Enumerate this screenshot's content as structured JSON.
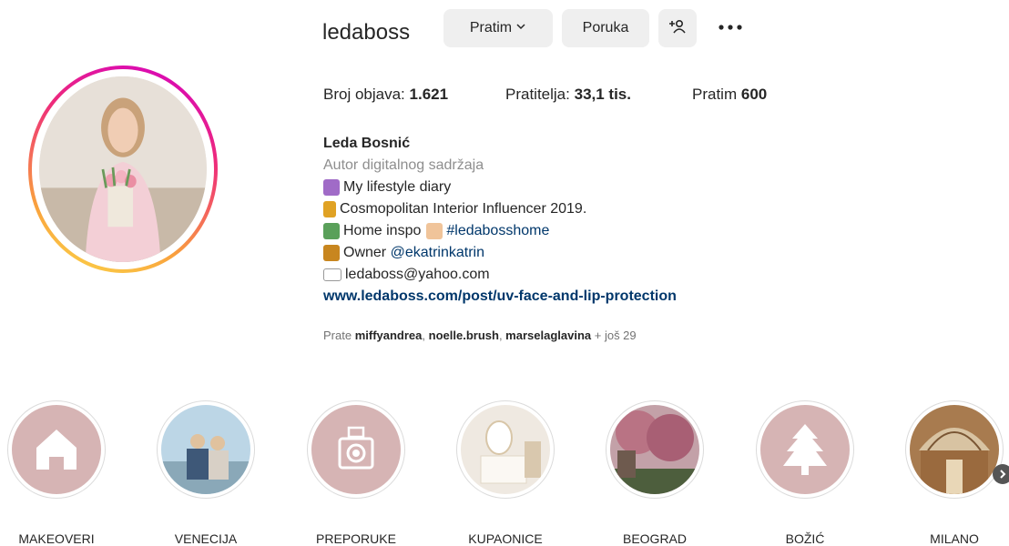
{
  "profile": {
    "username": "ledaboss",
    "follow_button": "Pratim",
    "message_button": "Poruka",
    "stats": {
      "posts_label": "Broj objava:",
      "posts_value": "1.621",
      "followers_label": "Pratitelja:",
      "followers_value": "33,1 tis.",
      "following_label": "Pratim",
      "following_value": "600"
    },
    "bio": {
      "full_name": "Leda Bosnić",
      "category": "Autor digitalnog sadržaja",
      "line1": "My lifestyle diary",
      "line2": "Cosmopolitan Interior Influencer 2019.",
      "line3_text": "Home inspo",
      "line3_tag": "#ledabosshome",
      "line4_text": "Owner",
      "line4_mention": "@ekatrinkatrin",
      "line5": "ledaboss@yahoo.com",
      "website": "www.ledaboss.com/post/uv-face-and-lip-protection"
    },
    "followed_by": {
      "prefix": "Prate",
      "user1": "miffyandrea",
      "user2": "noelle.brush",
      "user3": "marselaglavina",
      "suffix": "+ još 29"
    }
  },
  "highlights": [
    {
      "label": "MAKEOVERI",
      "icon": "house-icon"
    },
    {
      "label": "VENECIJA",
      "icon": "photo"
    },
    {
      "label": "PREPORUKE",
      "icon": "camera-icon"
    },
    {
      "label": "KUPAONICE",
      "icon": "photo"
    },
    {
      "label": "BEOGRAD",
      "icon": "photo"
    },
    {
      "label": "BOŽIĆ",
      "icon": "tree-icon"
    },
    {
      "label": "MILANO",
      "icon": "photo"
    }
  ],
  "colors": {
    "highlight_pink": "#d6b4b4",
    "link_blue": "#00376b",
    "button_gray": "#efefef"
  }
}
